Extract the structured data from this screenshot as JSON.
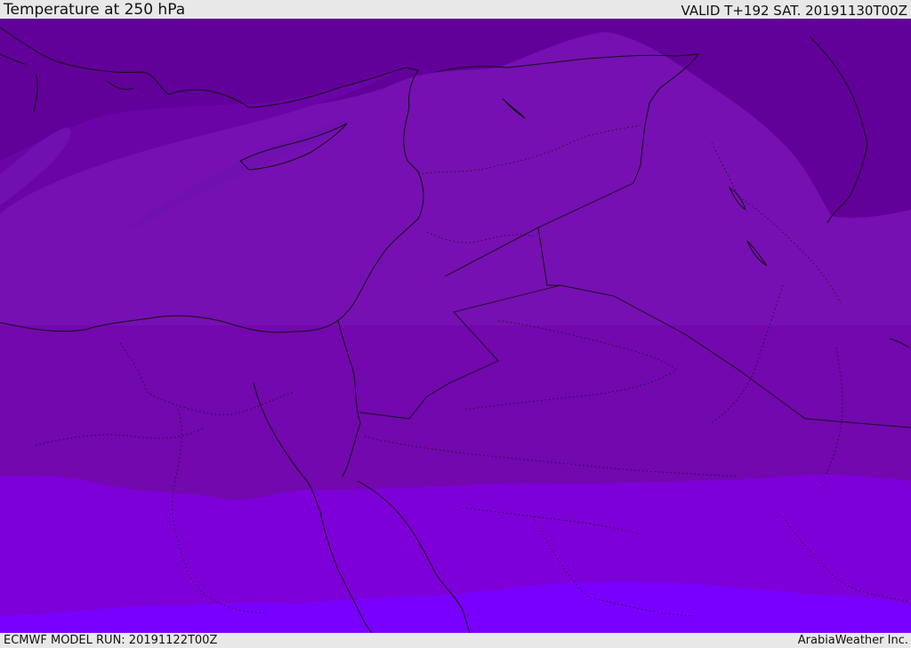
{
  "header": {
    "title": "Temperature at 250 hPa",
    "valid": "VALID T+192 SAT. 20191130T00Z"
  },
  "footer": {
    "model_run": "ECMWF MODEL RUN: 20191122T00Z",
    "credit": "ArabiaWeather Inc."
  },
  "map": {
    "field": "temperature",
    "level": "250 hPa",
    "colors": {
      "darkest_violet": "#62009a",
      "dark_violet": "#6a04a6",
      "medium_violet": "#7610b2",
      "band_violet": "#7208ae",
      "bright_violet": "#7e00d8",
      "brightest_violet": "#7900ff",
      "coastline": "#111111"
    }
  }
}
